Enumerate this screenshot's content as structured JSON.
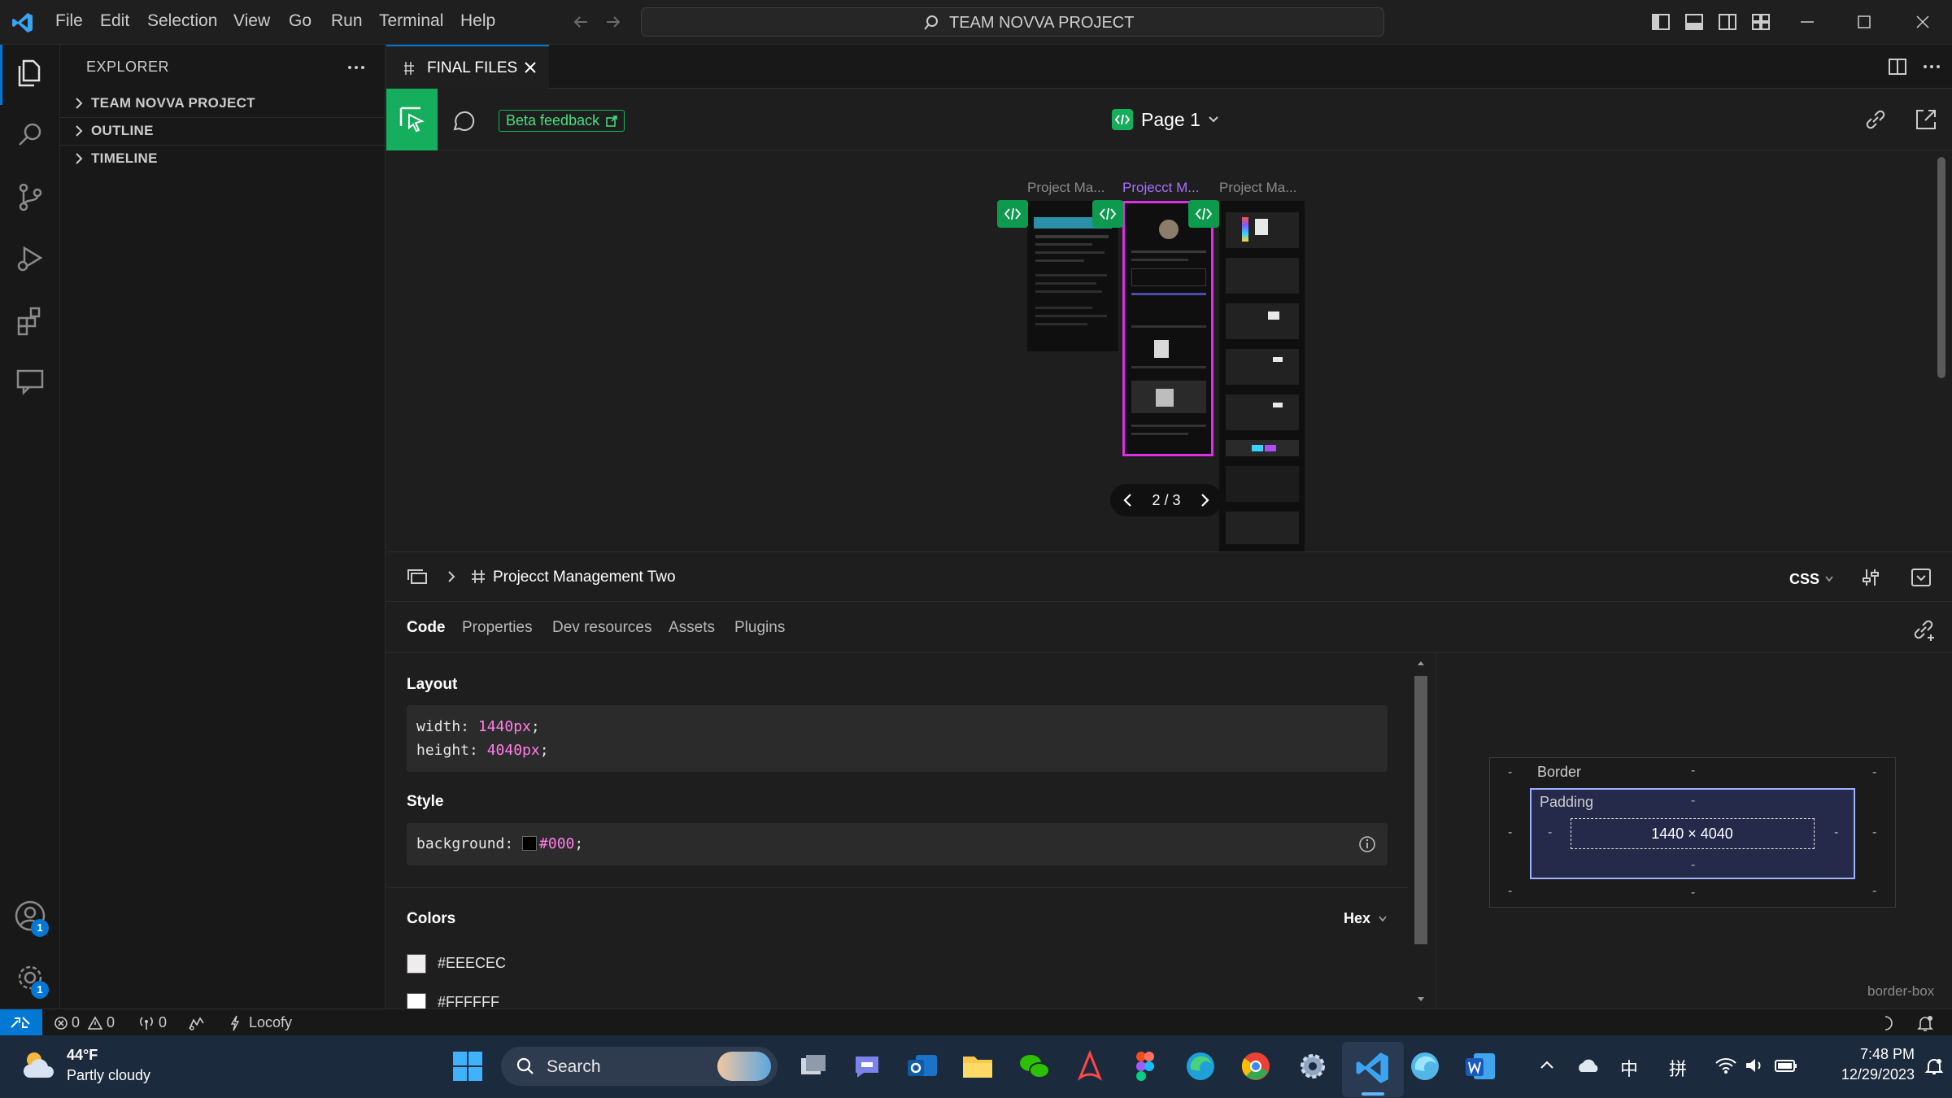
{
  "titlebar": {
    "menu": [
      "File",
      "Edit",
      "Selection",
      "View",
      "Go",
      "Run",
      "Terminal",
      "Help"
    ],
    "search_text": "TEAM NOVVA PROJECT"
  },
  "activity": {
    "accounts_badge": "1",
    "settings_badge": "1"
  },
  "sidebar": {
    "title": "EXPLORER",
    "sections": [
      "TEAM NOVVA PROJECT",
      "OUTLINE",
      "TIMELINE"
    ]
  },
  "editor_tab": {
    "label": "FINAL FILES"
  },
  "plugin_toolbar": {
    "beta_label": "Beta feedback",
    "page_label": "Page 1"
  },
  "canvas": {
    "frames": [
      "Project Ma...",
      "Projecct M...",
      "Project Ma..."
    ],
    "pager": "2 / 3"
  },
  "devpanel": {
    "breadcrumb": "Projecct Management Two",
    "lang": "CSS",
    "tabs": [
      "Code",
      "Properties",
      "Dev resources",
      "Assets",
      "Plugins"
    ],
    "layout_title": "Layout",
    "layout_lines": [
      {
        "prop": "width: ",
        "val": "1440px",
        "end": ";"
      },
      {
        "prop": "height: ",
        "val": "4040px",
        "end": ";"
      }
    ],
    "style_title": "Style",
    "style_prop": "background: ",
    "style_val": "#000",
    "style_end": ";",
    "colors_title": "Colors",
    "color_format": "Hex",
    "colors": [
      "#EEECEC",
      "#FFFFFF"
    ],
    "box_model": {
      "border_label": "Border",
      "padding_label": "Padding",
      "size": "1440 × 4040",
      "dash": "-",
      "sizing": "border-box"
    }
  },
  "statusbar": {
    "errors": "0",
    "warnings": "0",
    "ports": "0",
    "plugin": "Locofy"
  },
  "taskbar": {
    "temp": "44°F",
    "weather": "Partly cloudy",
    "search": "Search",
    "lang1": "中",
    "lang2": "拼",
    "time": "7:48 PM",
    "date": "12/29/2023"
  },
  "colors": {
    "accent": "#0078d4",
    "figma_green": "#14ae5c",
    "selection_magenta": "#e02ee6",
    "code_value": "#ff7eea"
  }
}
